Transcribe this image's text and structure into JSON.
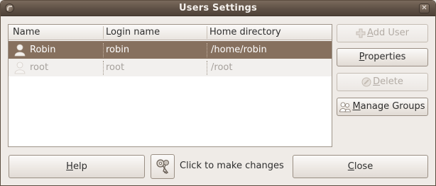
{
  "window": {
    "title": "Users Settings"
  },
  "columns": {
    "name": "Name",
    "login": "Login name",
    "home": "Home directory"
  },
  "users": [
    {
      "name": "Robin",
      "login": "robin",
      "home": "/home/robin",
      "selected": true
    },
    {
      "name": "root",
      "login": "root",
      "home": "/root",
      "selected": false
    }
  ],
  "buttons": {
    "add_user_mn": "A",
    "add_user_rest": "dd User",
    "properties_mn": "P",
    "properties_rest": "roperties",
    "delete_mn": "D",
    "delete_rest": "elete",
    "manage_groups_mn": "M",
    "manage_groups_rest": "anage Groups",
    "help_mn": "H",
    "help_rest": "elp",
    "close_mn": "C",
    "close_rest": "lose"
  },
  "lock": {
    "label": "Click to make changes"
  },
  "colors": {
    "selection": "#86705e",
    "titlebar": "#5e5045",
    "window_bg": "#efebe7"
  }
}
